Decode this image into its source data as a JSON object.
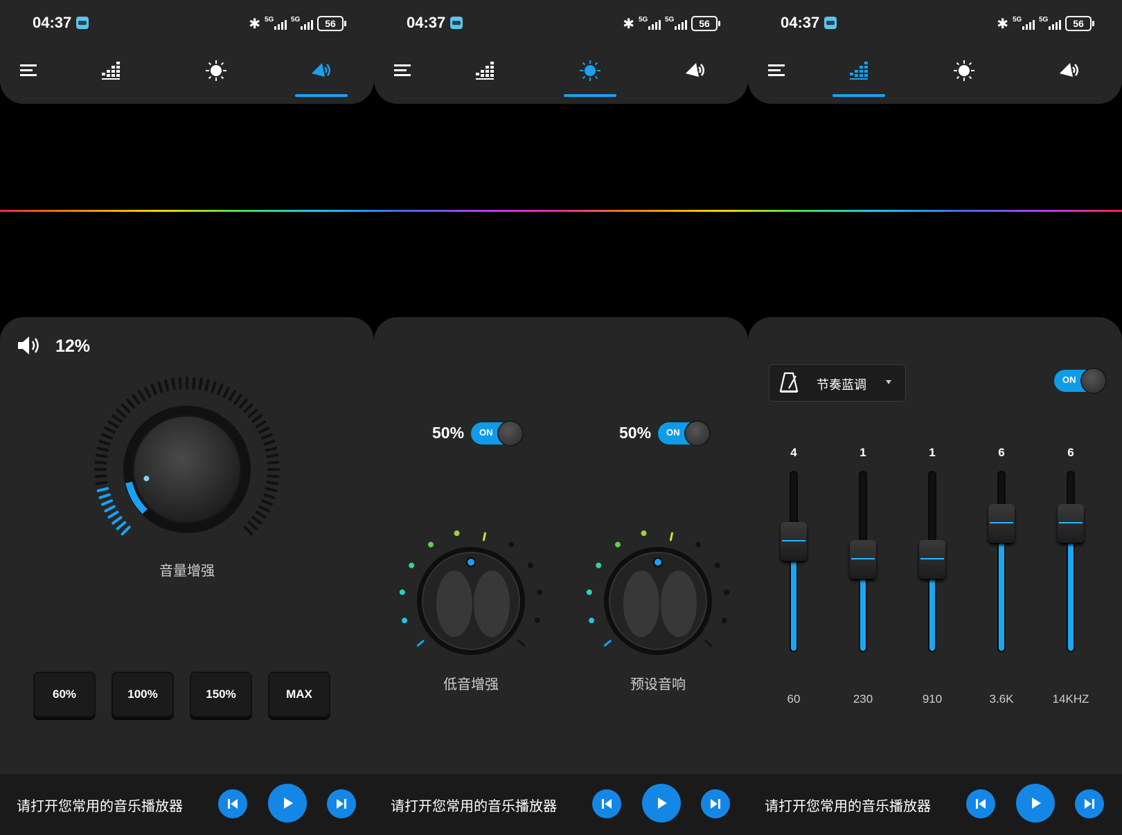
{
  "status": {
    "time": "04:37",
    "net1": "5G",
    "net2": "5G",
    "battery": "56"
  },
  "footer": {
    "hint": "请打开您常用的音乐播放器"
  },
  "panel1": {
    "volume_value": "12%",
    "knob_label": "音量增强",
    "knob_level": 0.12,
    "presets": [
      "60%",
      "100%",
      "150%",
      "MAX"
    ]
  },
  "panel2": {
    "bass": {
      "percent": "50%",
      "toggle": "ON",
      "label": "低音增强",
      "level": 0.5
    },
    "virtualizer": {
      "percent": "50%",
      "toggle": "ON",
      "label": "预设音响",
      "level": 0.5
    }
  },
  "panel3": {
    "preset_name": "节奏蓝调",
    "toggle": "ON",
    "bands": [
      {
        "value": "4",
        "freq": "60",
        "level": 0.62
      },
      {
        "value": "1",
        "freq": "230",
        "level": 0.52
      },
      {
        "value": "1",
        "freq": "910",
        "level": 0.52
      },
      {
        "value": "6",
        "freq": "3.6K",
        "level": 0.72
      },
      {
        "value": "6",
        "freq": "14KHZ",
        "level": 0.72
      }
    ]
  },
  "colors": {
    "accent": "#1aa1f2",
    "panel": "#262626",
    "footer": "#1a1a1a"
  },
  "tabs": [
    "menu-icon",
    "equalizer-icon",
    "bass-icon",
    "volume-boost-icon"
  ]
}
